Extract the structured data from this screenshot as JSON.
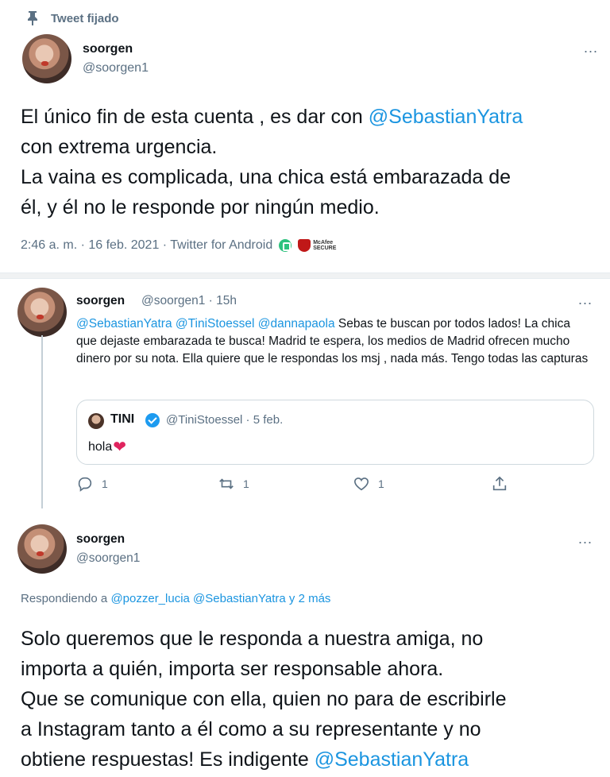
{
  "pinned_label": "Tweet fijado",
  "tweet1": {
    "name": "soorgen",
    "handle": "@soorgen1",
    "more": "...",
    "line1_pre": "El único fin de esta cuenta , es dar con ",
    "line1_mention": "@SebastianYatra",
    "line2": "con extrema urgencia.",
    "line3": "La vaina es complicada, una chica está embarazada de",
    "line4": "él, y él no le responde por ningún medio.",
    "meta": "2:46 a. m. · 16 feb. 2021 · Twitter for Android",
    "mcafee_line1": "McAfee",
    "mcafee_line2": "SECURE"
  },
  "tweet2": {
    "name": "soorgen",
    "handle_time": "@soorgen1 · 15h",
    "more": "...",
    "mention1": "@SebastianYatra",
    "mention2": "@TiniStoessel",
    "mention3": "@dannapaola",
    "text_after": " Sebas te buscan por todos lados! La chica que dejaste embarazada te busca! Madrid te espera, los medios de Madrid ofrecen mucho dinero por su nota. Ella quiere que le respondas los msj , nada más. Tengo todas las capturas",
    "quote": {
      "name": "TINI",
      "handle_time": "@TiniStoessel · 5 feb.",
      "text": "hola",
      "emoji": "❤"
    },
    "actions": {
      "reply_count": "1",
      "retweet_count": "1",
      "like_count": "1"
    }
  },
  "tweet3": {
    "name": "soorgen",
    "handle": "@soorgen1",
    "more": "...",
    "replying_prefix": "Respondiendo a ",
    "replying_mentions": "@pozzer_lucia @SebastianYatra",
    "replying_suffix": " y 2 más",
    "line1": "Solo queremos que le responda a nuestra amiga, no",
    "line2": "importa a quién, importa ser responsable ahora.",
    "line3": "Que se comunique con ella, quien no para de escribirle",
    "line4": "a Instagram tanto a él como a su representante y no",
    "line5_pre": "obtiene respuestas! Es indigente ",
    "line5_mention": "@SebastianYatra"
  },
  "colors": {
    "mention": "#1b95e0",
    "secondary": "#5b7083",
    "like": "#e0245e",
    "verified": "#1d9bf0"
  }
}
